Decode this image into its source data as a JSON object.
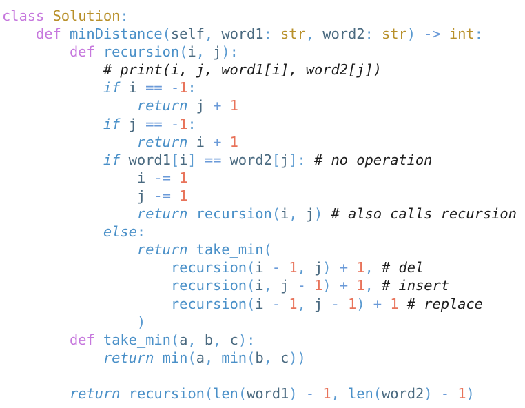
{
  "editor": {
    "lines": [
      {
        "indent": "",
        "tokens": [
          {
            "t": "class",
            "c": "kw"
          },
          {
            "t": " ",
            "c": "pl"
          },
          {
            "t": "Solution",
            "c": "cls"
          },
          {
            "t": ":",
            "c": "pu"
          }
        ]
      },
      {
        "indent": "    ",
        "tokens": [
          {
            "t": "def",
            "c": "kw"
          },
          {
            "t": " ",
            "c": "pl"
          },
          {
            "t": "minDistance",
            "c": "fn"
          },
          {
            "t": "(",
            "c": "pu"
          },
          {
            "t": "self",
            "c": "pl"
          },
          {
            "t": ", ",
            "c": "pu"
          },
          {
            "t": "word1",
            "c": "pl"
          },
          {
            "t": ": ",
            "c": "pu"
          },
          {
            "t": "str",
            "c": "ty"
          },
          {
            "t": ", ",
            "c": "pu"
          },
          {
            "t": "word2",
            "c": "pl"
          },
          {
            "t": ": ",
            "c": "pu"
          },
          {
            "t": "str",
            "c": "ty"
          },
          {
            "t": ") ",
            "c": "pu"
          },
          {
            "t": "->",
            "c": "op"
          },
          {
            "t": " ",
            "c": "pl"
          },
          {
            "t": "int",
            "c": "ty"
          },
          {
            "t": ":",
            "c": "pu"
          }
        ]
      },
      {
        "indent": "        ",
        "tokens": [
          {
            "t": "def",
            "c": "kw"
          },
          {
            "t": " ",
            "c": "pl"
          },
          {
            "t": "recursion",
            "c": "fn"
          },
          {
            "t": "(",
            "c": "pu"
          },
          {
            "t": "i",
            "c": "pl"
          },
          {
            "t": ", ",
            "c": "pu"
          },
          {
            "t": "j",
            "c": "pl"
          },
          {
            "t": "):",
            "c": "pu"
          }
        ]
      },
      {
        "indent": "            ",
        "tokens": [
          {
            "t": "# print(i, j, word1[i], word2[j])",
            "c": "cm"
          }
        ]
      },
      {
        "indent": "            ",
        "tokens": [
          {
            "t": "if",
            "c": "ctl"
          },
          {
            "t": " i ",
            "c": "pl"
          },
          {
            "t": "==",
            "c": "op"
          },
          {
            "t": " ",
            "c": "pl"
          },
          {
            "t": "-",
            "c": "op"
          },
          {
            "t": "1",
            "c": "num"
          },
          {
            "t": ":",
            "c": "pu"
          }
        ]
      },
      {
        "indent": "                ",
        "tokens": [
          {
            "t": "return",
            "c": "ctl"
          },
          {
            "t": " j ",
            "c": "pl"
          },
          {
            "t": "+",
            "c": "op"
          },
          {
            "t": " ",
            "c": "pl"
          },
          {
            "t": "1",
            "c": "num"
          }
        ]
      },
      {
        "indent": "            ",
        "tokens": [
          {
            "t": "if",
            "c": "ctl"
          },
          {
            "t": " j ",
            "c": "pl"
          },
          {
            "t": "==",
            "c": "op"
          },
          {
            "t": " ",
            "c": "pl"
          },
          {
            "t": "-",
            "c": "op"
          },
          {
            "t": "1",
            "c": "num"
          },
          {
            "t": ":",
            "c": "pu"
          }
        ]
      },
      {
        "indent": "                ",
        "tokens": [
          {
            "t": "return",
            "c": "ctl"
          },
          {
            "t": " i ",
            "c": "pl"
          },
          {
            "t": "+",
            "c": "op"
          },
          {
            "t": " ",
            "c": "pl"
          },
          {
            "t": "1",
            "c": "num"
          }
        ]
      },
      {
        "indent": "            ",
        "tokens": [
          {
            "t": "if",
            "c": "ctl"
          },
          {
            "t": " word1",
            "c": "pl"
          },
          {
            "t": "[",
            "c": "pu"
          },
          {
            "t": "i",
            "c": "pl"
          },
          {
            "t": "]",
            "c": "pu"
          },
          {
            "t": " ",
            "c": "pl"
          },
          {
            "t": "==",
            "c": "op"
          },
          {
            "t": " word2",
            "c": "pl"
          },
          {
            "t": "[",
            "c": "pu"
          },
          {
            "t": "j",
            "c": "pl"
          },
          {
            "t": "]:",
            "c": "pu"
          },
          {
            "t": " ",
            "c": "pl"
          },
          {
            "t": "# no operation",
            "c": "cm"
          }
        ]
      },
      {
        "indent": "                ",
        "tokens": [
          {
            "t": "i ",
            "c": "pl"
          },
          {
            "t": "-=",
            "c": "op"
          },
          {
            "t": " ",
            "c": "pl"
          },
          {
            "t": "1",
            "c": "num"
          }
        ]
      },
      {
        "indent": "                ",
        "tokens": [
          {
            "t": "j ",
            "c": "pl"
          },
          {
            "t": "-=",
            "c": "op"
          },
          {
            "t": " ",
            "c": "pl"
          },
          {
            "t": "1",
            "c": "num"
          }
        ]
      },
      {
        "indent": "                ",
        "tokens": [
          {
            "t": "return",
            "c": "ctl"
          },
          {
            "t": " ",
            "c": "pl"
          },
          {
            "t": "recursion",
            "c": "fn"
          },
          {
            "t": "(",
            "c": "pu"
          },
          {
            "t": "i",
            "c": "pl"
          },
          {
            "t": ", ",
            "c": "pu"
          },
          {
            "t": "j",
            "c": "pl"
          },
          {
            "t": ")",
            "c": "pu"
          },
          {
            "t": " ",
            "c": "pl"
          },
          {
            "t": "# also calls recursion",
            "c": "cm"
          }
        ]
      },
      {
        "indent": "            ",
        "tokens": [
          {
            "t": "else",
            "c": "ctl"
          },
          {
            "t": ":",
            "c": "pu"
          }
        ]
      },
      {
        "indent": "                ",
        "tokens": [
          {
            "t": "return",
            "c": "ctl"
          },
          {
            "t": " ",
            "c": "pl"
          },
          {
            "t": "take_min",
            "c": "fn"
          },
          {
            "t": "(",
            "c": "pu"
          }
        ]
      },
      {
        "indent": "                    ",
        "tokens": [
          {
            "t": "recursion",
            "c": "fn"
          },
          {
            "t": "(",
            "c": "pu"
          },
          {
            "t": "i ",
            "c": "pl"
          },
          {
            "t": "-",
            "c": "op"
          },
          {
            "t": " ",
            "c": "pl"
          },
          {
            "t": "1",
            "c": "num"
          },
          {
            "t": ", ",
            "c": "pu"
          },
          {
            "t": "j",
            "c": "pl"
          },
          {
            "t": ")",
            "c": "pu"
          },
          {
            "t": " ",
            "c": "pl"
          },
          {
            "t": "+",
            "c": "op"
          },
          {
            "t": " ",
            "c": "pl"
          },
          {
            "t": "1",
            "c": "num"
          },
          {
            "t": ",",
            "c": "pu"
          },
          {
            "t": " ",
            "c": "pl"
          },
          {
            "t": "# del",
            "c": "cm"
          }
        ]
      },
      {
        "indent": "                    ",
        "tokens": [
          {
            "t": "recursion",
            "c": "fn"
          },
          {
            "t": "(",
            "c": "pu"
          },
          {
            "t": "i",
            "c": "pl"
          },
          {
            "t": ", ",
            "c": "pu"
          },
          {
            "t": "j ",
            "c": "pl"
          },
          {
            "t": "-",
            "c": "op"
          },
          {
            "t": " ",
            "c": "pl"
          },
          {
            "t": "1",
            "c": "num"
          },
          {
            "t": ")",
            "c": "pu"
          },
          {
            "t": " ",
            "c": "pl"
          },
          {
            "t": "+",
            "c": "op"
          },
          {
            "t": " ",
            "c": "pl"
          },
          {
            "t": "1",
            "c": "num"
          },
          {
            "t": ",",
            "c": "pu"
          },
          {
            "t": " ",
            "c": "pl"
          },
          {
            "t": "# insert",
            "c": "cm"
          }
        ]
      },
      {
        "indent": "                    ",
        "tokens": [
          {
            "t": "recursion",
            "c": "fn"
          },
          {
            "t": "(",
            "c": "pu"
          },
          {
            "t": "i ",
            "c": "pl"
          },
          {
            "t": "-",
            "c": "op"
          },
          {
            "t": " ",
            "c": "pl"
          },
          {
            "t": "1",
            "c": "num"
          },
          {
            "t": ", ",
            "c": "pu"
          },
          {
            "t": "j ",
            "c": "pl"
          },
          {
            "t": "-",
            "c": "op"
          },
          {
            "t": " ",
            "c": "pl"
          },
          {
            "t": "1",
            "c": "num"
          },
          {
            "t": ")",
            "c": "pu"
          },
          {
            "t": " ",
            "c": "pl"
          },
          {
            "t": "+",
            "c": "op"
          },
          {
            "t": " ",
            "c": "pl"
          },
          {
            "t": "1",
            "c": "num"
          },
          {
            "t": " ",
            "c": "pl"
          },
          {
            "t": "# replace",
            "c": "cm"
          }
        ]
      },
      {
        "indent": "                ",
        "tokens": [
          {
            "t": ")",
            "c": "pu"
          }
        ]
      },
      {
        "indent": "        ",
        "tokens": [
          {
            "t": "def",
            "c": "kw"
          },
          {
            "t": " ",
            "c": "pl"
          },
          {
            "t": "take_min",
            "c": "fn"
          },
          {
            "t": "(",
            "c": "pu"
          },
          {
            "t": "a",
            "c": "pl"
          },
          {
            "t": ", ",
            "c": "pu"
          },
          {
            "t": "b",
            "c": "pl"
          },
          {
            "t": ", ",
            "c": "pu"
          },
          {
            "t": "c",
            "c": "pl"
          },
          {
            "t": "):",
            "c": "pu"
          }
        ]
      },
      {
        "indent": "            ",
        "tokens": [
          {
            "t": "return",
            "c": "ctl"
          },
          {
            "t": " ",
            "c": "pl"
          },
          {
            "t": "min",
            "c": "fn"
          },
          {
            "t": "(",
            "c": "pu"
          },
          {
            "t": "a",
            "c": "pl"
          },
          {
            "t": ", ",
            "c": "pu"
          },
          {
            "t": "min",
            "c": "fn"
          },
          {
            "t": "(",
            "c": "pu"
          },
          {
            "t": "b",
            "c": "pl"
          },
          {
            "t": ", ",
            "c": "pu"
          },
          {
            "t": "c",
            "c": "pl"
          },
          {
            "t": "))",
            "c": "pu"
          }
        ]
      },
      {
        "indent": "",
        "tokens": []
      },
      {
        "indent": "        ",
        "tokens": [
          {
            "t": "return",
            "c": "ctl"
          },
          {
            "t": " ",
            "c": "pl"
          },
          {
            "t": "recursion",
            "c": "fn"
          },
          {
            "t": "(",
            "c": "pu"
          },
          {
            "t": "len",
            "c": "fn"
          },
          {
            "t": "(",
            "c": "pu"
          },
          {
            "t": "word1",
            "c": "pl"
          },
          {
            "t": ")",
            "c": "pu"
          },
          {
            "t": " ",
            "c": "pl"
          },
          {
            "t": "-",
            "c": "op"
          },
          {
            "t": " ",
            "c": "pl"
          },
          {
            "t": "1",
            "c": "num"
          },
          {
            "t": ", ",
            "c": "pu"
          },
          {
            "t": "len",
            "c": "fn"
          },
          {
            "t": "(",
            "c": "pu"
          },
          {
            "t": "word2",
            "c": "pl"
          },
          {
            "t": ")",
            "c": "pu"
          },
          {
            "t": " ",
            "c": "pl"
          },
          {
            "t": "-",
            "c": "op"
          },
          {
            "t": " ",
            "c": "pl"
          },
          {
            "t": "1",
            "c": "num"
          },
          {
            "t": ")",
            "c": "pu"
          }
        ]
      }
    ]
  }
}
